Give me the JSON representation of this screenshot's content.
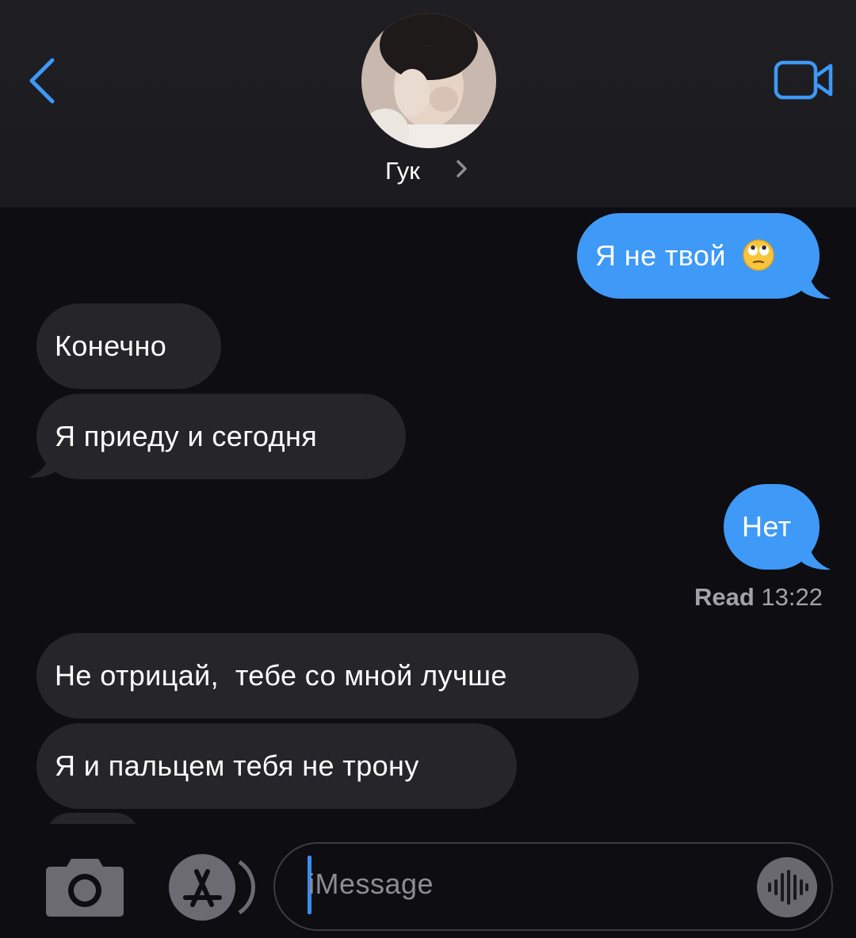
{
  "header": {
    "contact_name": "Гук",
    "back_icon": "chevron-left-icon",
    "video_icon": "video-camera-icon",
    "accent_color": "#3e99f7"
  },
  "messages": [
    {
      "direction": "outgoing",
      "text": "Я не твой",
      "emoji": "face-with-rolling-eyes-icon"
    },
    {
      "direction": "incoming",
      "text": "Конечно"
    },
    {
      "direction": "incoming",
      "text": "Я приеду и сегодня"
    },
    {
      "direction": "outgoing",
      "text": "Нет"
    },
    {
      "direction": "incoming",
      "text": "Не отрицай,  тебе со мной лучше"
    },
    {
      "direction": "incoming",
      "text": "Я и пальцем тебя не трону"
    }
  ],
  "read_receipt": {
    "label": "Read",
    "time": "13:22"
  },
  "composer": {
    "placeholder": "iMessage",
    "camera_icon": "camera-icon",
    "apps_icon": "app-store-icon",
    "audio_icon": "waveform-icon"
  },
  "colors": {
    "outgoing_bubble": "#3e99f7",
    "incoming_bubble": "#262529",
    "background": "#0e0d11"
  }
}
